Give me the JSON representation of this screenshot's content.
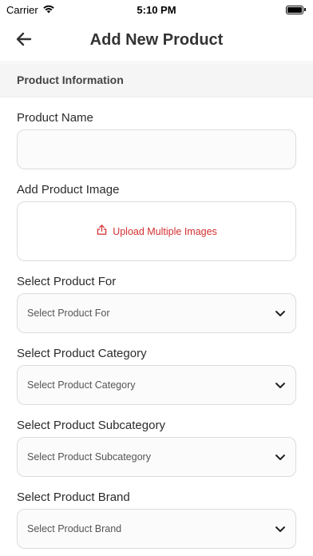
{
  "status_bar": {
    "carrier": "Carrier",
    "time": "5:10 PM"
  },
  "header": {
    "title": "Add New Product",
    "back_icon": "arrow-left-icon"
  },
  "section": {
    "title": "Product Information"
  },
  "form": {
    "product_name": {
      "label": "Product Name",
      "value": "",
      "placeholder": ""
    },
    "product_image": {
      "label": "Add Product Image",
      "upload_text": "Upload Multiple Images",
      "icon": "upload-icon"
    },
    "product_for": {
      "label": "Select Product For",
      "placeholder": "Select Product For"
    },
    "product_category": {
      "label": "Select Product Category",
      "placeholder": "Select Product Category"
    },
    "product_subcategory": {
      "label": "Select Product Subcategory",
      "placeholder": "Select Product Subcategory"
    },
    "product_brand": {
      "label": "Select Product Brand",
      "placeholder": "Select Product Brand"
    }
  },
  "colors": {
    "accent": "#d32f2f",
    "section_bg": "#f5f5f5",
    "border": "#dcdcdc"
  }
}
